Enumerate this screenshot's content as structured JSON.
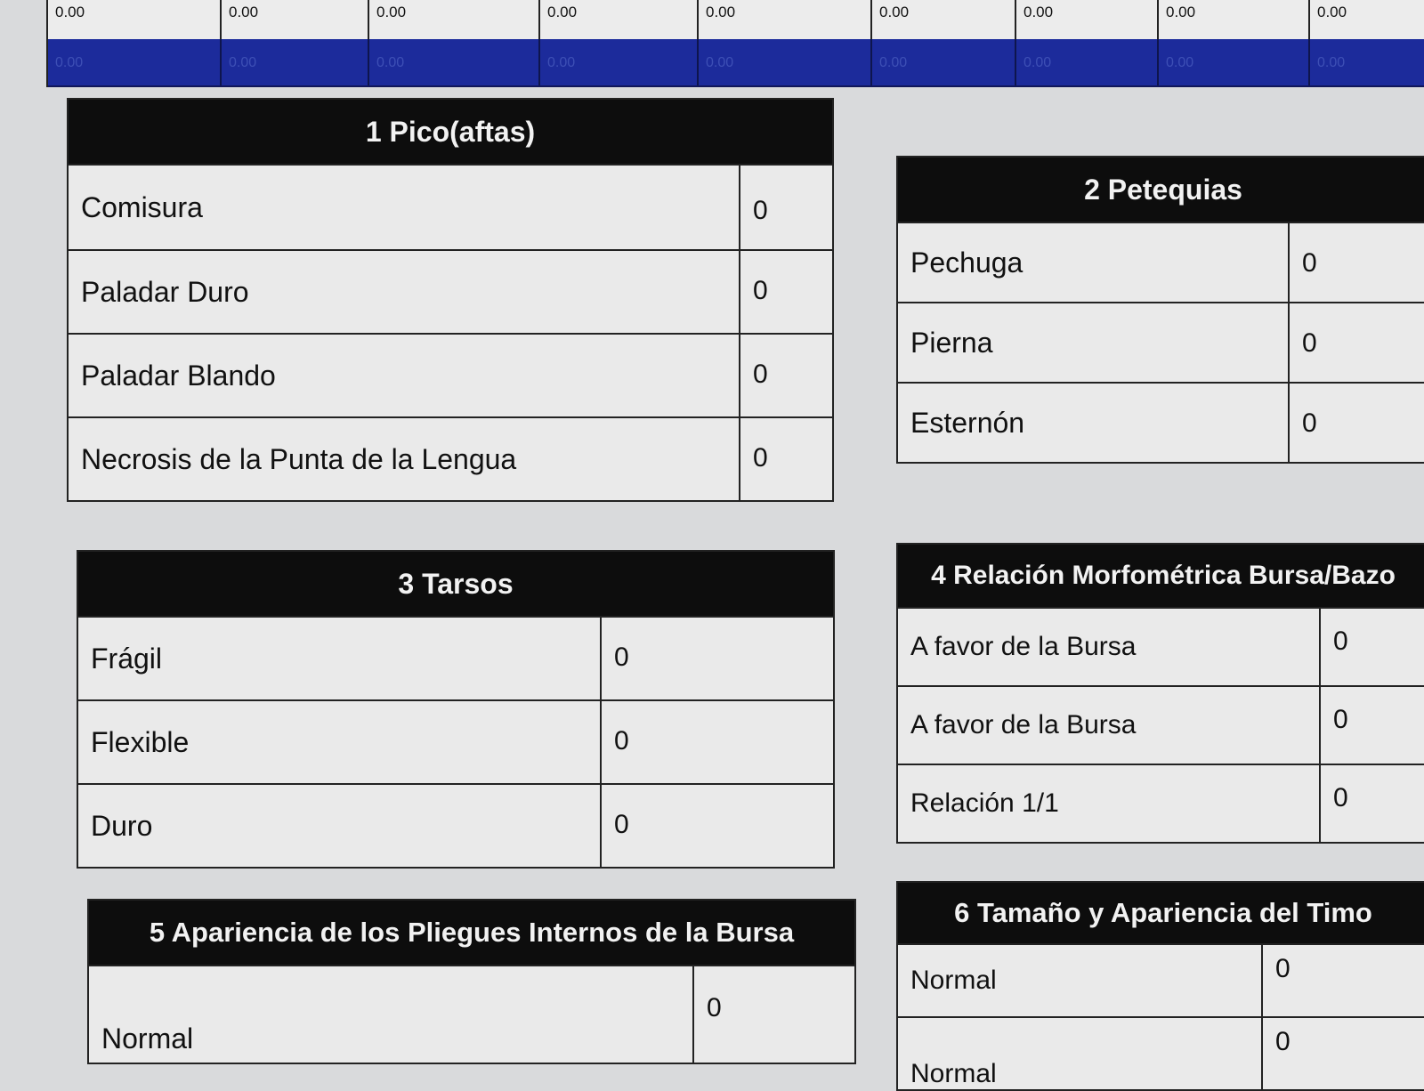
{
  "summary": {
    "light_row": [
      "0.00",
      "0.00",
      "0.00",
      "0.00",
      "0.00",
      "0.00",
      "0.00",
      "0.00",
      "0.00"
    ],
    "dark_row": [
      "0.00",
      "0.00",
      "0.00",
      "0.00",
      "0.00",
      "0.00",
      "0.00",
      "0.00",
      "0.00"
    ]
  },
  "panels": {
    "pico": {
      "title": "1 Pico(aftas)",
      "rows": [
        {
          "label": "Comisura",
          "value": "0"
        },
        {
          "label": "Paladar Duro",
          "value": "0"
        },
        {
          "label": "Paladar Blando",
          "value": "0"
        },
        {
          "label": "Necrosis de la Punta de la Lengua",
          "value": "0"
        }
      ]
    },
    "petequias": {
      "title": "2 Petequias",
      "rows": [
        {
          "label": "Pechuga",
          "value": "0"
        },
        {
          "label": "Pierna",
          "value": "0"
        },
        {
          "label": "Esternón",
          "value": "0"
        }
      ]
    },
    "tarsos": {
      "title": "3 Tarsos",
      "rows": [
        {
          "label": "Frágil",
          "value": "0"
        },
        {
          "label": "Flexible",
          "value": "0"
        },
        {
          "label": "Duro",
          "value": "0"
        }
      ]
    },
    "relacion": {
      "title": "4 Relación Morfométrica Bursa/Bazo",
      "rows": [
        {
          "label": "A favor de la Bursa",
          "value": "0"
        },
        {
          "label": "A favor de la Bursa",
          "value": "0"
        },
        {
          "label": "Relación 1/1",
          "value": "0"
        }
      ]
    },
    "pliegues": {
      "title": "5 Apariencia de los Pliegues Internos de la Bursa",
      "rows": [
        {
          "label": "Normal",
          "value": "0"
        }
      ]
    },
    "timo": {
      "title": "6 Tamaño y Apariencia del Timo",
      "rows": [
        {
          "label": "Normal",
          "value": "0"
        },
        {
          "label": "Normal",
          "value": "0"
        }
      ]
    }
  }
}
